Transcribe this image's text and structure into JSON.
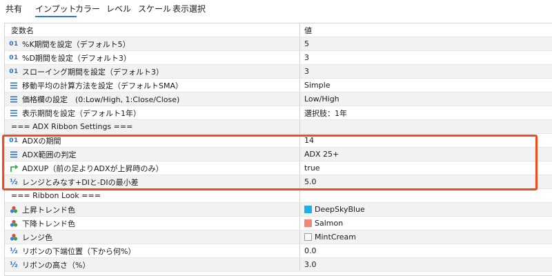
{
  "tabs": [
    "共有",
    "インプット",
    "カラー",
    "レベル",
    "スケール",
    "表示選択"
  ],
  "active_tab": "インプット",
  "columns": {
    "name": "変数名",
    "value": "値"
  },
  "rows": [
    {
      "icon": "01",
      "name": "%K期間を設定（デフォルト5）",
      "value": "5"
    },
    {
      "icon": "01",
      "name": "%D期間を設定（デフォルト3）",
      "value": "3"
    },
    {
      "icon": "01",
      "name": "スローイング期間を設定（デフォルト3）",
      "value": "3"
    },
    {
      "icon": "list",
      "name": "移動平均の計算方法を設定（デフォルトSMA）",
      "value": "Simple"
    },
    {
      "icon": "list",
      "name": "価格欄の設定　(0:Low/High, 1:Close/Close)",
      "value": "Low/High"
    },
    {
      "icon": "list",
      "name": "表示期間を設定（デフォルト1年）",
      "value": "選択肢：1年"
    },
    {
      "icon": "none",
      "name": "=== ADX Ribbon Settings ===",
      "value": ""
    },
    {
      "icon": "01",
      "name": "ADXの期間",
      "value": "14"
    },
    {
      "icon": "list",
      "name": "ADX範囲の判定",
      "value": "ADX 25+"
    },
    {
      "icon": "bool",
      "name": "ADXUP（前の足よりADXが上昇時のみ）",
      "value": "true"
    },
    {
      "icon": "half",
      "name": "レンジとみなす+DIと-DIの最小差",
      "value": "5.0"
    },
    {
      "icon": "none",
      "name": "=== Ribbon Look ===",
      "value": ""
    },
    {
      "icon": "color",
      "name": "上昇トレンド色",
      "value": "DeepSkyBlue",
      "swatch": "#1eaee8"
    },
    {
      "icon": "color",
      "name": "下降トレンド色",
      "value": "Salmon",
      "swatch": "#f08878"
    },
    {
      "icon": "color",
      "name": "レンジ色",
      "value": "MintCream",
      "swatch": "#f5fffa"
    },
    {
      "icon": "half",
      "name": "リボンの下端位置（下から何%）",
      "value": "0.0"
    },
    {
      "icon": "half",
      "name": "リボンの高さ（%）",
      "value": "3.0"
    }
  ],
  "highlight_color": "#f24a1d"
}
